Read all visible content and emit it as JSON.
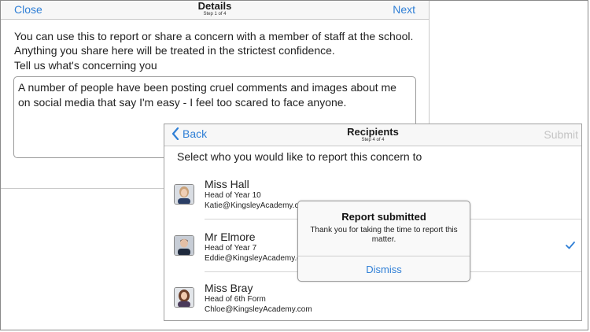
{
  "details": {
    "close_label": "Close",
    "title": "Details",
    "step": "Step 1 of 4",
    "next_label": "Next",
    "intro": "You can use this to report or share a concern with a member of staff at the school. Anything you share here will be treated in the strictest confidence.",
    "prompt": "Tell us what's concerning you",
    "concern_text": "A number of people have been posting cruel comments and images about me on social media that say I'm easy - I feel too scared to face anyone."
  },
  "recipients": {
    "back_label": "Back",
    "back_icon": "chevron-left-icon",
    "title": "Recipients",
    "step": "Step 4 of 4",
    "submit_label": "Submit",
    "heading": "Select who you would like to report this concern to",
    "list": [
      {
        "name": "Miss Hall",
        "role": "Head of Year 10",
        "email": "Katie@KingsleyAcademy.c",
        "selected": false
      },
      {
        "name": "Mr Elmore",
        "role": "Head of Year 7",
        "email": "Eddie@KingsleyAcademy.c",
        "selected": true
      },
      {
        "name": "Miss Bray",
        "role": "Head of 6th Form",
        "email": "Chloe@KingsleyAcademy.com",
        "selected": false
      }
    ],
    "checkmark_icon": "checkmark-icon"
  },
  "alert": {
    "title": "Report submitted",
    "message": "Thank you for taking the time to report this matter.",
    "dismiss_label": "Dismiss"
  },
  "colors": {
    "accent": "#2f7fd6",
    "disabled": "#c4c4c4"
  }
}
